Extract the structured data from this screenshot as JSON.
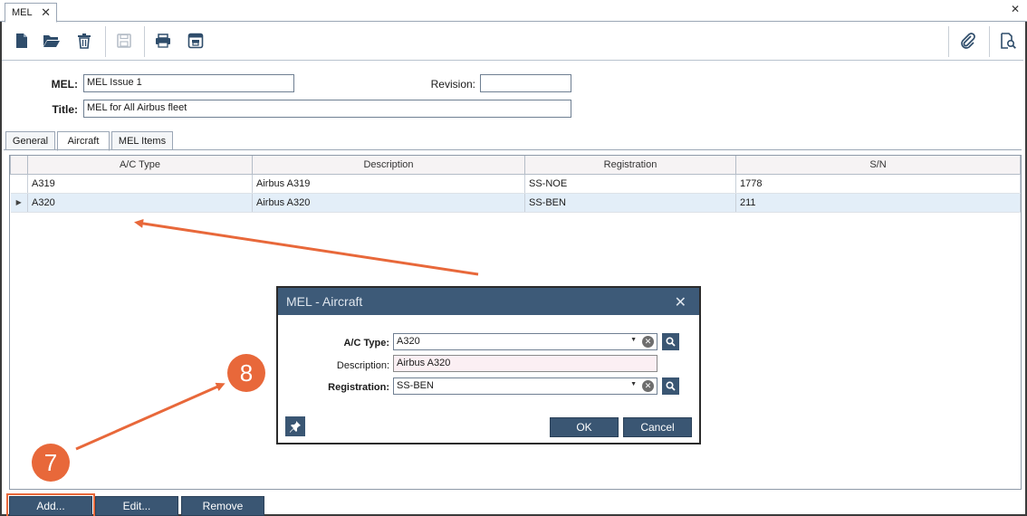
{
  "document_tab": {
    "label": "MEL",
    "close_glyph": "✕"
  },
  "strip_close_glyph": "✕",
  "toolbar": {
    "icons": [
      "new-document-icon",
      "open-folder-icon",
      "delete-trash-icon",
      "save-icon",
      "print-icon",
      "print-preview-icon",
      "attachment-icon",
      "document-search-icon"
    ]
  },
  "header": {
    "mel_label": "MEL:",
    "mel_value": "MEL Issue 1",
    "revision_label": "Revision:",
    "revision_value": "",
    "title_label": "Title:",
    "title_value": "MEL for All Airbus fleet"
  },
  "tabs": [
    {
      "label": "General",
      "active": false
    },
    {
      "label": "Aircraft",
      "active": true
    },
    {
      "label": "MEL Items",
      "active": false
    }
  ],
  "grid": {
    "columns": [
      "A/C Type",
      "Description",
      "Registration",
      "S/N"
    ],
    "rows": [
      {
        "ac_type": "A319",
        "description": "Airbus A319",
        "registration": "SS-NOE",
        "sn": "1778",
        "selected": false,
        "indicator": ""
      },
      {
        "ac_type": "A320",
        "description": "Airbus A320",
        "registration": "SS-BEN",
        "sn": "211",
        "selected": true,
        "indicator": "▶"
      }
    ]
  },
  "buttons": {
    "add": "Add...",
    "edit": "Edit...",
    "remove": "Remove"
  },
  "dialog": {
    "title": "MEL - Aircraft",
    "close_glyph": "✕",
    "ac_type_label": "A/C Type:",
    "ac_type_value": "A320",
    "description_label": "Description:",
    "description_value": "Airbus A320",
    "registration_label": "Registration:",
    "registration_value": "SS-BEN",
    "ok": "OK",
    "cancel": "Cancel",
    "combo_arrow": "▼",
    "clear_glyph": "✕"
  },
  "annotations": {
    "step_7": "7",
    "step_8": "8",
    "color": "#e8683a"
  },
  "colors": {
    "accent": "#3a5673",
    "dialog_title": "#3d5a78",
    "selected_row": "#e3eef8",
    "readonly_field": "#fbeff3"
  }
}
